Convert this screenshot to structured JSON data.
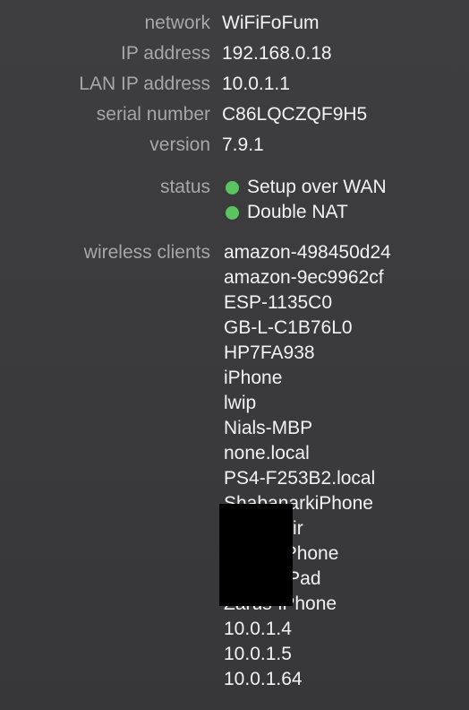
{
  "info": {
    "network": {
      "label": "network",
      "value": "WiFiFoFum"
    },
    "ip_address": {
      "label": "IP address",
      "value": "192.168.0.18"
    },
    "lan_ip_address": {
      "label": "LAN IP address",
      "value": "10.0.1.1"
    },
    "serial_number": {
      "label": "serial number",
      "value": "C86LQCZQF9H5"
    },
    "version": {
      "label": "version",
      "value": "7.9.1"
    }
  },
  "status": {
    "label": "status",
    "items": [
      {
        "text": "Setup over WAN",
        "color": "#5ac560"
      },
      {
        "text": "Double NAT",
        "color": "#5ac560"
      }
    ]
  },
  "wireless_clients": {
    "label": "wireless clients",
    "items": [
      "amazon-498450d24",
      "amazon-9ec9962cf",
      "ESP-1135C0",
      "GB-L-C1B76L0",
      "HP7FA938",
      "iPhone",
      "lwip",
      "Nials-MBP",
      "none.local",
      "PS4-F253B2.local",
      "ShabanarkiPhone",
      "Lucas-Air",
      "Lucas-iPhone",
      "GCtersiPad",
      "Zarus-iPhone",
      "10.0.1.4",
      "10.0.1.5",
      "10.0.1.64"
    ]
  },
  "colors": {
    "background": "#3c3c3e",
    "label": "#a7a7a9",
    "value": "#f2f2f2",
    "status_ok": "#5ac560",
    "redaction": "#000000"
  }
}
